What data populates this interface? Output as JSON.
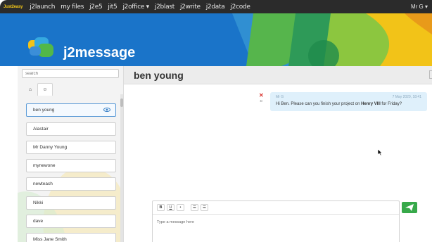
{
  "nav": {
    "brand": "Just2easy",
    "items": [
      "j2launch",
      "my files",
      "j2e5",
      "jit5",
      "j2office ▾",
      "j2blast",
      "j2write",
      "j2data",
      "j2code"
    ],
    "user": "Mr G ▾"
  },
  "app": {
    "title": "j2message",
    "logo_icon": "speech-bubbles-icon"
  },
  "sidebar": {
    "search_placeholder": "search",
    "tabs": [
      {
        "icon": "home-icon",
        "glyph": "⌂"
      },
      {
        "icon": "group-icon",
        "glyph": "☺"
      }
    ],
    "contacts": [
      {
        "name": "ben young",
        "active": true
      },
      {
        "name": "Alastair",
        "active": false
      },
      {
        "name": "Mr Danny Young",
        "active": false
      },
      {
        "name": "mynewone",
        "active": false
      },
      {
        "name": "newteach",
        "active": false
      },
      {
        "name": "Nikki",
        "active": false
      },
      {
        "name": "dave",
        "active": false
      },
      {
        "name": "Miss Jane Smith",
        "active": false
      }
    ]
  },
  "conversation": {
    "contact_name": "ben young",
    "messages": [
      {
        "from": "Mr G",
        "date": "7 May 2020, 18:41",
        "text_before": "Hi Ben. Please can you finish your project on ",
        "text_bold": "Henry VIII",
        "text_after": " for Friday?"
      }
    ]
  },
  "composer": {
    "toolbar": [
      "B",
      "U",
      "•",
      "☰",
      "☰"
    ],
    "placeholder": "Type a message here"
  },
  "colors": {
    "nav_bg": "#2b2b2b",
    "banner_blue": "#1a74c9",
    "accent_green": "#37a94a",
    "bubble": "#dff0fb",
    "delete_red": "#d9322c"
  }
}
